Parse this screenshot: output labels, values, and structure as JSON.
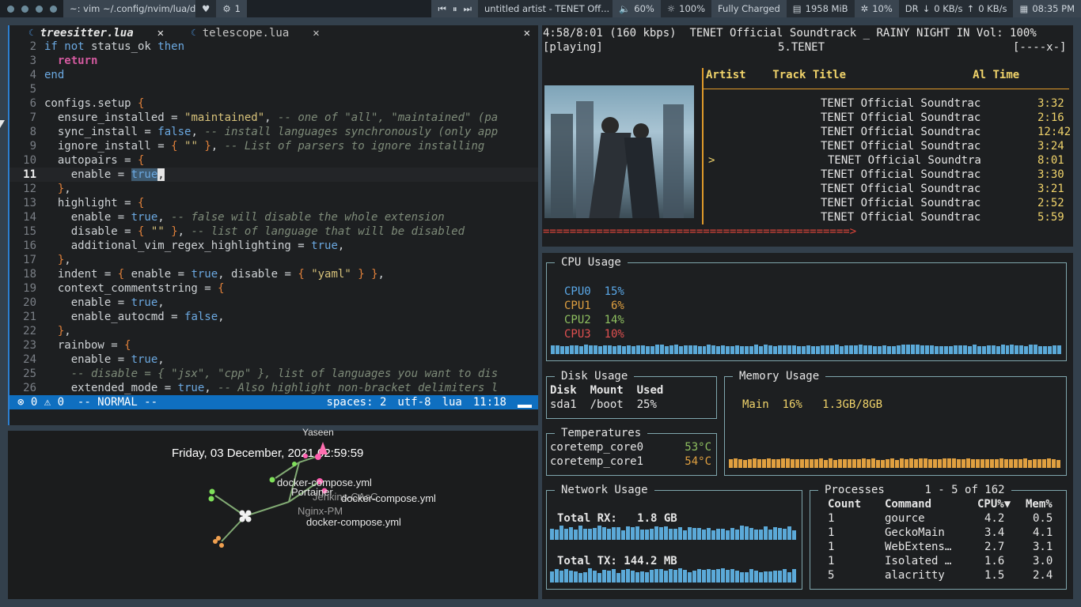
{
  "topbar": {
    "terminal_title": "~: vim ~/.config/nvim/lua/d...",
    "workspace": "1",
    "media_title": "untitled artist - TENET Off...",
    "volume": "60%",
    "brightness": "100%",
    "battery": "Fully Charged",
    "memory": "1958 MiB",
    "cpu": "10%",
    "net_dev": "DR",
    "down": "0 KB/s",
    "up": "0 KB/s",
    "clock": "08:35 PM"
  },
  "vim": {
    "tabs": [
      {
        "label": "treesitter.lua",
        "close": "✕"
      },
      {
        "label": "telescope.lua",
        "close": "✕"
      }
    ],
    "close_all": "✕",
    "status": {
      "errors": "0",
      "warnings": "0",
      "mode": "-- NORMAL --",
      "indent": "spaces: 2",
      "encoding": "utf-8",
      "filetype": "lua",
      "position": "11:18"
    }
  },
  "graph": {
    "date": "Friday, 03 December, 2021 02:59:59",
    "user": "Yaseen",
    "labels": [
      "docker-compose.yml",
      "Portainer",
      "Jenkins-CAsC",
      "docker-compose.yml",
      "Nginx-PM",
      "docker-compose.yml"
    ]
  },
  "player": {
    "time": "4:58/8:01",
    "bitrate": "(160 kbps)",
    "title_scroll": "TENET Official Soundtrack _ RAINY NIGHT IN",
    "volume": "Vol: 100%",
    "state": "[playing]",
    "current": "5.TENET",
    "flags": "[----x-]",
    "headers": {
      "artist": "Artist",
      "track": "Track Title",
      "album": "Al",
      "time": "Time"
    },
    "tracks": [
      {
        "title": "TENET Official Soundtrac",
        "time": "3:32",
        "current": false
      },
      {
        "title": "TENET Official Soundtrac",
        "time": "2:16",
        "current": false
      },
      {
        "title": "TENET Official Soundtrac",
        "time": "12:42",
        "current": false
      },
      {
        "title": "TENET Official Soundtrac",
        "time": "3:24",
        "current": false
      },
      {
        "title": "TENET Official Soundtra",
        "time": "8:01",
        "current": true
      },
      {
        "title": "TENET Official Soundtrac",
        "time": "3:30",
        "current": false
      },
      {
        "title": "TENET Official Soundtrac",
        "time": "3:21",
        "current": false
      },
      {
        "title": "TENET Official Soundtrac",
        "time": "2:52",
        "current": false
      },
      {
        "title": "TENET Official Soundtrac",
        "time": "5:59",
        "current": false
      }
    ],
    "current_marker": ">",
    "progress": "==============================================>",
    "progress_fraction": 0.62
  },
  "gtop": {
    "cpu_title": "CPU Usage",
    "cpus": [
      {
        "name": "CPU0",
        "value": "15%",
        "color": "#5aa8e8"
      },
      {
        "name": "CPU1",
        "value": " 6%",
        "color": "#e0a040"
      },
      {
        "name": "CPU2",
        "value": "14%",
        "color": "#8fc060"
      },
      {
        "name": "CPU3",
        "value": "10%",
        "color": "#e05050"
      }
    ],
    "disk_title": "Disk Usage",
    "disk_headers": [
      "Disk",
      "Mount",
      "Used"
    ],
    "disk_row": [
      "sda1",
      "/boot",
      "25%"
    ],
    "memory_title": "Memory Usage",
    "memory_row": {
      "name": "Main",
      "pct": "16%",
      "amount": "1.3GB/8GB"
    },
    "temp_title": "Temperatures",
    "temps": [
      {
        "name": "coretemp_core0",
        "value": "53°C"
      },
      {
        "name": "coretemp_core1",
        "value": "54°C"
      }
    ],
    "net_title": "Network Usage",
    "rx": "Total RX:   1.8 GB",
    "tx": "Total TX: 144.2 MB",
    "proc_title": "Processes",
    "proc_range": "1 - 5 of 162",
    "proc_headers": [
      "Count",
      "Command",
      "CPU%▼",
      "Mem%"
    ],
    "procs": [
      [
        "1",
        "gource",
        "4.2",
        "0.5"
      ],
      [
        "1",
        "GeckoMain",
        "3.4",
        "4.1"
      ],
      [
        "1",
        "WebExtens…",
        "2.7",
        "3.1"
      ],
      [
        "1",
        "Isolated …",
        "1.6",
        "3.0"
      ],
      [
        "5",
        "alacritty",
        "1.5",
        "2.4"
      ]
    ]
  }
}
